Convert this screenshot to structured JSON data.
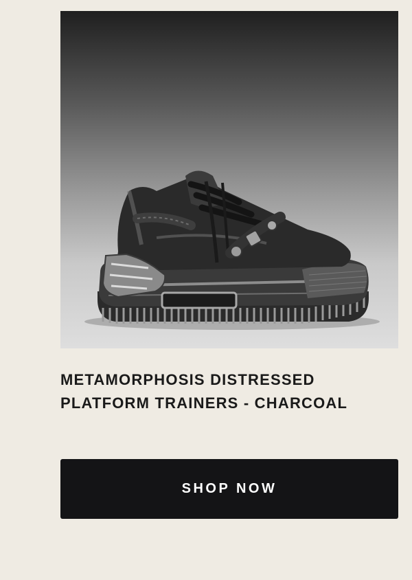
{
  "product": {
    "image_alt": "Metamorphosis distressed platform trainer in charcoal",
    "title_line1": "METAMORPHOSIS DISTRESSED",
    "title_line2": "PLATFORM TRAINERS - CHARCOAL"
  },
  "cta": {
    "label": "SHOP NOW"
  },
  "colors": {
    "page_background": "#efebe3",
    "title_text": "#1a1a1a",
    "button_background": "#141416",
    "button_text": "#ffffff"
  }
}
